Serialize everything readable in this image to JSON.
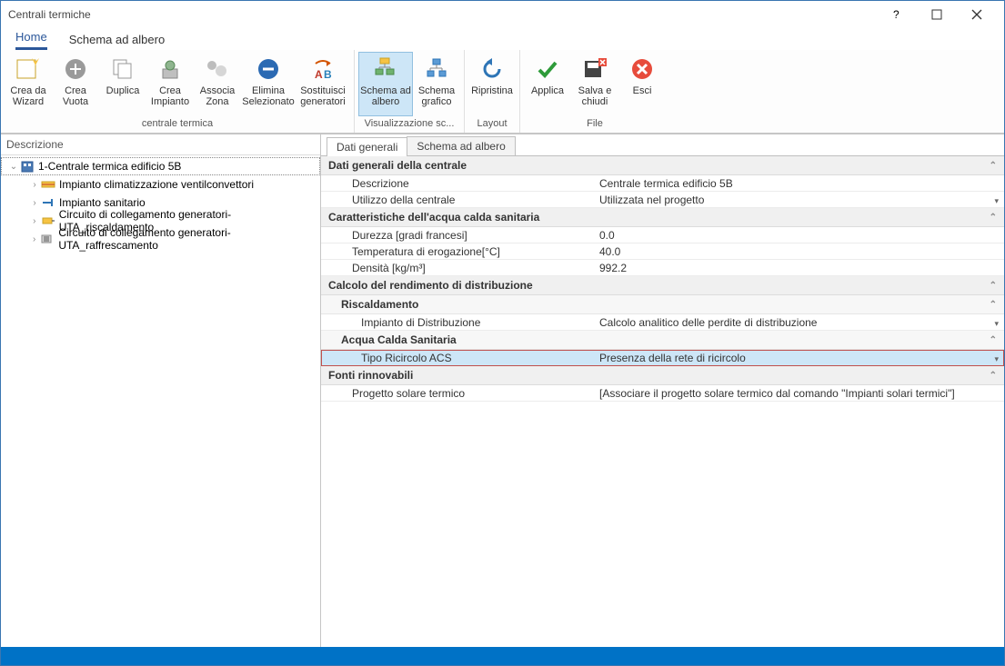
{
  "window": {
    "title": "Centrali termiche"
  },
  "ribbonTabs": {
    "home": "Home",
    "schema": "Schema ad albero"
  },
  "ribbon": {
    "group1": {
      "label": "centrale termica",
      "btns": {
        "wizard": "Crea da\nWizard",
        "vuota": "Crea\nVuota",
        "duplica": "Duplica",
        "impianto": "Crea\nImpianto",
        "zona": "Associa\nZona",
        "elimina": "Elimina\nSelezionato",
        "sostituisci": "Sostituisci\ngeneratori"
      }
    },
    "group2": {
      "label": "Visualizzazione sc...",
      "btns": {
        "albero": "Schema ad\nalbero",
        "grafico": "Schema\ngrafico"
      }
    },
    "group3": {
      "label": "Layout",
      "btns": {
        "ripristina": "Ripristina"
      }
    },
    "group4": {
      "label": "File",
      "btns": {
        "applica": "Applica",
        "salva": "Salva e\nchiudi",
        "esci": "Esci"
      }
    }
  },
  "tree": {
    "header": "Descrizione",
    "root": "1-Centrale termica edificio 5B",
    "children": [
      "Impianto climatizzazione ventilconvettori",
      "Impianto sanitario",
      "Circuito di collegamento generatori-UTA_riscaldamento",
      "Circuito di collegamento generatori- UTA_raffrescamento"
    ]
  },
  "propTabs": {
    "generali": "Dati generali",
    "schema": "Schema ad albero"
  },
  "sections": {
    "s1": {
      "title": "Dati generali della centrale",
      "rows": [
        {
          "k": "Descrizione",
          "v": "Centrale termica edificio 5B"
        },
        {
          "k": "Utilizzo della centrale",
          "v": "Utilizzata nel progetto"
        }
      ]
    },
    "s2": {
      "title": "Caratteristiche dell'acqua calda sanitaria",
      "rows": [
        {
          "k": "Durezza [gradi francesi]",
          "v": "0.0"
        },
        {
          "k": "Temperatura di erogazione[°C]",
          "v": "40.0"
        },
        {
          "k": "Densità [kg/m³]",
          "v": "992.2"
        }
      ]
    },
    "s3": {
      "title": "Calcolo del rendimento di distribuzione",
      "sub1": {
        "title": "Riscaldamento",
        "rows": [
          {
            "k": "Impianto di  Distribuzione",
            "v": "Calcolo analitico delle perdite di distribuzione"
          }
        ]
      },
      "sub2": {
        "title": "Acqua Calda Sanitaria",
        "rows": [
          {
            "k": "Tipo Ricircolo ACS",
            "v": "Presenza della rete di ricircolo"
          }
        ]
      }
    },
    "s4": {
      "title": "Fonti rinnovabili",
      "rows": [
        {
          "k": "Progetto solare termico",
          "v": "[Associare il progetto solare termico dal comando \"Impianti solari termici\"]"
        }
      ]
    }
  }
}
